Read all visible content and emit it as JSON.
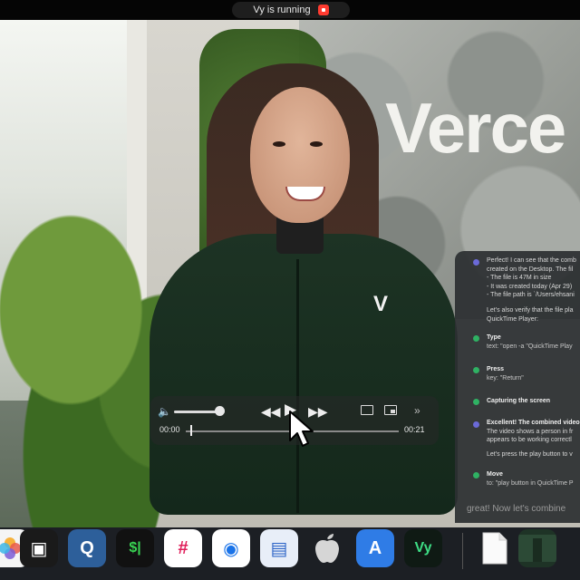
{
  "status_bar": {
    "label": "Vy is running"
  },
  "background": {
    "logo_text": "Verce"
  },
  "hoodie_badge": "V",
  "player": {
    "volume_level": 0.9,
    "progress": 0.02,
    "time_elapsed": "00:00",
    "time_total": "00:21"
  },
  "agent_panel": {
    "intro": [
      "Perfect! I can see that the comb",
      "created on the Desktop. The fil",
      "- The file is 47M in size",
      "- It was created today (Apr 29)",
      "- The file path is `/Users/ehsani"
    ],
    "verify": [
      "Let's also verify that the file pla",
      "QuickTime Player:"
    ],
    "steps": [
      {
        "title": "Type",
        "sub": "text: \"open -a \"QuickTime Play",
        "status": "done"
      },
      {
        "title": "Press",
        "sub": "key: \"Return\"",
        "status": "done"
      },
      {
        "title": "Capturing the screen",
        "sub": "",
        "status": "done"
      }
    ],
    "result": [
      "Excellent! The combined video i",
      "The video shows a person in fr",
      "appears to be working correctl"
    ],
    "play_note": "Let's press the play button to v",
    "move_step": {
      "title": "Move",
      "sub": "to: \"play button in QuickTime P",
      "status": "done"
    },
    "input_text": "great! Now let's combine"
  },
  "dock": [
    {
      "name": "photos-app-icon",
      "bg": "#f5f5f5",
      "glyph": ""
    },
    {
      "name": "3d-box-app-icon",
      "bg": "#1a1a1a",
      "glyph": "▣"
    },
    {
      "name": "quicktime-app-icon",
      "bg": "#2d5f9a",
      "glyph": "Q"
    },
    {
      "name": "terminal-app-icon",
      "bg": "#111111",
      "glyph": "$|"
    },
    {
      "name": "slack-app-icon",
      "bg": "#ffffff",
      "glyph": "#"
    },
    {
      "name": "chrome-app-icon",
      "bg": "#ffffff",
      "glyph": "◉"
    },
    {
      "name": "preview-app-icon",
      "bg": "#e8eef8",
      "glyph": "▤"
    },
    {
      "name": "apple-icon",
      "bg": "transparent",
      "glyph": ""
    },
    {
      "name": "xcode-app-icon",
      "bg": "#2f7ce6",
      "glyph": "A"
    },
    {
      "name": "vy-app-icon",
      "bg": "#0f1a14",
      "glyph": "Vy"
    },
    {
      "name": "document-file-icon",
      "bg": "#f3f3f3",
      "glyph": ""
    },
    {
      "name": "video-thumbnail-icon",
      "bg": "#1e3326",
      "glyph": ""
    }
  ]
}
